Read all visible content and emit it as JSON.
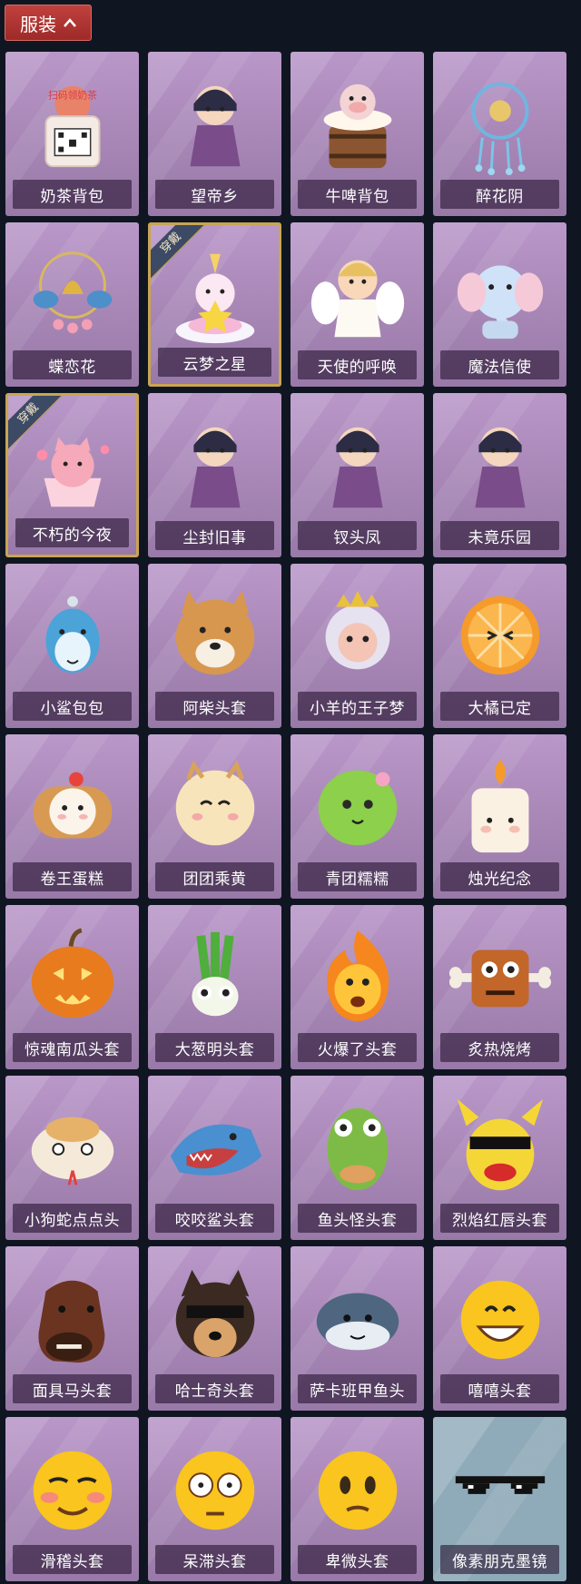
{
  "header": {
    "tab_label": "服装"
  },
  "equipped_badge": "穿戴",
  "items": [
    {
      "name": "奶茶背包",
      "icon": "milk-tea-backpack",
      "sign": "扫码领奶茶",
      "equipped": false
    },
    {
      "name": "望帝乡",
      "icon": "doll-character",
      "equipped": false
    },
    {
      "name": "牛啤背包",
      "icon": "cow-beer-backpack",
      "equipped": false
    },
    {
      "name": "醉花阴",
      "icon": "blue-floral-ornament",
      "equipped": false
    },
    {
      "name": "蝶恋花",
      "icon": "butterfly-bell",
      "equipped": false
    },
    {
      "name": "云梦之星",
      "icon": "unicorn-cloud-star",
      "equipped": true
    },
    {
      "name": "天使的呼唤",
      "icon": "angel-doll",
      "equipped": false
    },
    {
      "name": "魔法信使",
      "icon": "elephant",
      "equipped": false
    },
    {
      "name": "不朽的今夜",
      "icon": "pink-cat-cup",
      "equipped": true
    },
    {
      "name": "尘封旧事",
      "icon": "doll-character",
      "equipped": false
    },
    {
      "name": "钗头凤",
      "icon": "doll-character",
      "equipped": false
    },
    {
      "name": "未竟乐园",
      "icon": "doll-character",
      "equipped": false
    },
    {
      "name": "小鲨包包",
      "icon": "shark-bag",
      "equipped": false
    },
    {
      "name": "阿柴头套",
      "icon": "shiba-head",
      "equipped": false
    },
    {
      "name": "小羊的王子梦",
      "icon": "sheep-prince-head",
      "equipped": false
    },
    {
      "name": "大橘已定",
      "icon": "orange-slice",
      "equipped": false
    },
    {
      "name": "卷王蛋糕",
      "icon": "cake-roll",
      "equipped": false
    },
    {
      "name": "团团乘黄",
      "icon": "cream-creature",
      "equipped": false
    },
    {
      "name": "青团糯糯",
      "icon": "green-dumpling",
      "equipped": false
    },
    {
      "name": "烛光纪念",
      "icon": "candle",
      "equipped": false
    },
    {
      "name": "惊魂南瓜头套",
      "icon": "pumpkin-head",
      "equipped": false
    },
    {
      "name": "大葱明头套",
      "icon": "scallion-head",
      "equipped": false
    },
    {
      "name": "火爆了头套",
      "icon": "fire-head",
      "equipped": false
    },
    {
      "name": "炙热烧烤",
      "icon": "bbq-meat-head",
      "equipped": false
    },
    {
      "name": "小狗蛇点点头",
      "icon": "snake-head",
      "equipped": false
    },
    {
      "name": "咬咬鲨头套",
      "icon": "shark-head",
      "equipped": false
    },
    {
      "name": "鱼头怪头套",
      "icon": "fish-monster-head",
      "equipped": false
    },
    {
      "name": "烈焰红唇头套",
      "icon": "pikachu-lips-head",
      "equipped": false
    },
    {
      "name": "面具马头套",
      "icon": "horse-mask",
      "equipped": false
    },
    {
      "name": "哈士奇头套",
      "icon": "husky-head",
      "equipped": false
    },
    {
      "name": "萨卡班甲鱼头",
      "icon": "sacabambaspis-head",
      "equipped": false
    },
    {
      "name": "嘻嘻头套",
      "icon": "grin-emoji-head",
      "equipped": false
    },
    {
      "name": "滑稽头套",
      "icon": "smirk-emoji-head",
      "equipped": false
    },
    {
      "name": "呆滞头套",
      "icon": "dazed-emoji-head",
      "equipped": false
    },
    {
      "name": "卑微头套",
      "icon": "humble-emoji-head",
      "equipped": false
    },
    {
      "name": "像素朋克墨镜",
      "icon": "pixel-sunglasses",
      "equipped": false,
      "special": true
    }
  ]
}
